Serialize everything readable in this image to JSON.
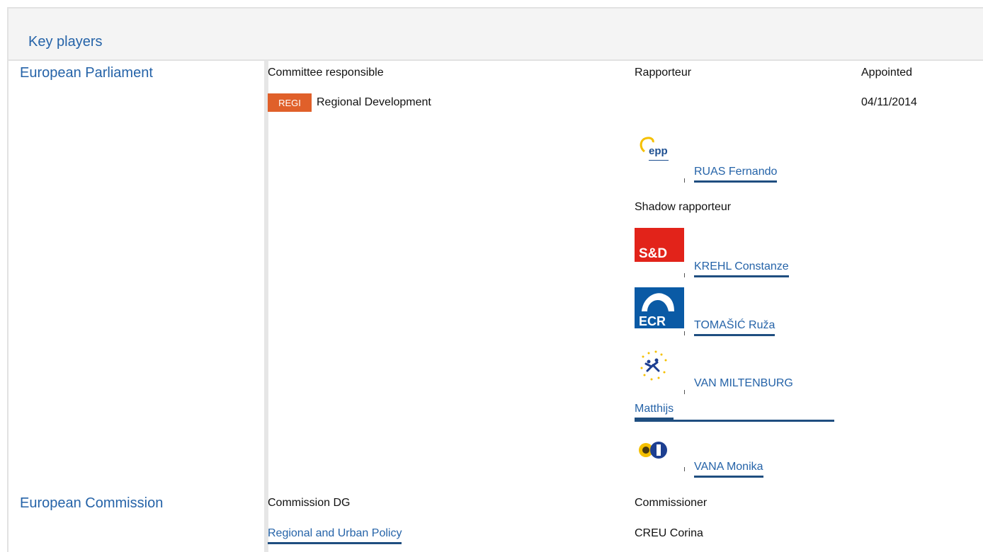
{
  "header": {
    "title": "Key players"
  },
  "parliament": {
    "label": "European Parliament",
    "col_committee": "Committee responsible",
    "col_rapporteur": "Rapporteur",
    "col_appointed": "Appointed",
    "committee_badge": "REGI",
    "committee_name": "Regional Development",
    "appointed_date": "04/11/2014",
    "rapporteur": {
      "name": "RUAS Fernando",
      "group_logo": "epp-logo",
      "logo_text": "epp"
    },
    "shadow_label": "Shadow rapporteur",
    "shadows": [
      {
        "name": "KREHL Constanze",
        "group_logo": "sd-logo",
        "logo_text": "S&D"
      },
      {
        "name": "TOMAŠIĆ Ruža",
        "group_logo": "ecr-logo",
        "logo_text": "ECR"
      },
      {
        "name_line1": "VAN MILTENBURG",
        "name_line2": "Matthijs",
        "group_logo": "alde-logo"
      },
      {
        "name": "VANA Monika",
        "group_logo": "greens-efa-logo"
      }
    ]
  },
  "commission": {
    "label": "European Commission",
    "col_dg": "Commission DG",
    "col_commissioner": "Commissioner",
    "dg_name": "Regional and Urban Policy",
    "commissioner_name": "CREU Corina"
  },
  "colors": {
    "link": "#2563a8",
    "badge": "#e0602a",
    "sd_red": "#e2231a",
    "ecr_blue": "#0a5aa5"
  }
}
